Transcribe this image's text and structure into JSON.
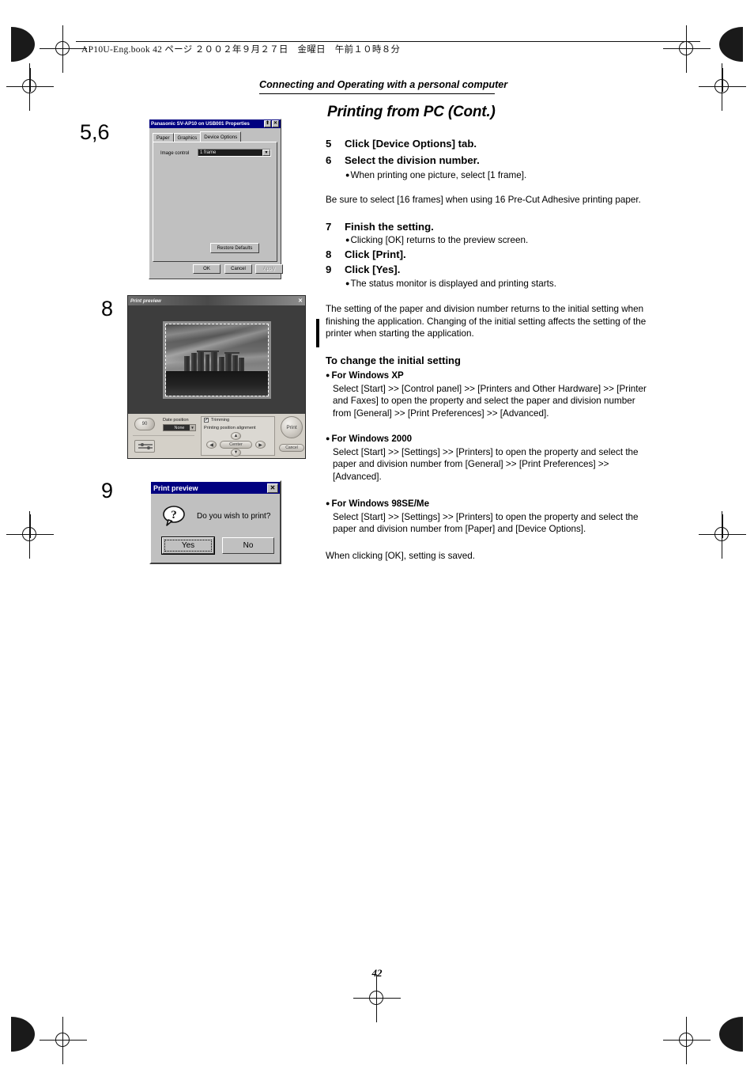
{
  "page": {
    "book_header": "AP10U-Eng.book  42 ページ  ２００２年９月２７日　金曜日　午前１０時８分",
    "section_label": "Connecting and Operating with a personal computer",
    "title": "Printing from PC (Cont.)",
    "folio": "42"
  },
  "gutter": {
    "step56": "5,6",
    "step8": "8",
    "step9": "9"
  },
  "steps": [
    {
      "num": "5",
      "text": "Click [Device Options] tab."
    },
    {
      "num": "6",
      "text": "Select the division number."
    },
    {
      "num": "7",
      "text": "Finish the setting."
    },
    {
      "num": "8",
      "text": "Click [Print]."
    },
    {
      "num": "9",
      "text": "Click [Yes]."
    }
  ],
  "bullets": {
    "one_picture": "When printing one picture, select [1 frame].",
    "clicking_ok": "Clicking [OK] returns to the preview screen.",
    "status_monitor": "The status monitor is displayed and printing starts.",
    "dot": "●"
  },
  "paragraphs": {
    "precut": "Be sure to select [16 frames] when using 16 Pre-Cut Adhesive printing paper.",
    "initial_setting": "The setting of the paper and division number returns to the initial setting when finishing the application. Changing of the initial setting affects the setting of the printer when starting the application.",
    "when_clicking_ok": "When clicking [OK], setting is saved."
  },
  "sub_head": "To change the initial setting",
  "os_sections": [
    {
      "head": "For Windows XP",
      "body": "Select [Start] >> [Control panel] >> [Printers and Other Hardware] >> [Printer and Faxes] to open the property and select the paper and division number from [General] >> [Print Preferences] >> [Advanced]."
    },
    {
      "head": "For Windows 2000",
      "body": "Select [Start] >> [Settings] >> [Printers] to open the property and select the paper and division number from [General] >> [Print Preferences] >> [Advanced]."
    },
    {
      "head": "For Windows 98SE/Me",
      "body": "Select [Start] >> [Settings] >> [Printers] to open the property and select the paper and division number from [Paper] and [Device Options]."
    }
  ],
  "properties_dialog": {
    "title": "Panasonic SV-AP10 on USB001 Properties",
    "minimize_glyph": "⬆",
    "close_glyph": "✕",
    "tabs": [
      {
        "label": "Paper",
        "active": false
      },
      {
        "label": "Graphics",
        "active": false
      },
      {
        "label": "Device Options",
        "active": true
      }
    ],
    "field_label": "Image control",
    "field_value": "1 frame",
    "dropdown_glyph": "▼",
    "restore_defaults": "Restore Defaults",
    "ok": "OK",
    "cancel": "Cancel",
    "apply": "Apply"
  },
  "print_preview_window": {
    "title": "Print preview",
    "close_glyph": "✕",
    "rotate_label": "90",
    "date_position_label": "Date position",
    "date_position_value": "None",
    "trimming_label": "Trimming",
    "trimming_checked": "✔",
    "alignment_label": "Printing position alignment",
    "center_label": "Center",
    "arrow_up": "▲",
    "arrow_down": "▼",
    "arrow_left": "◀",
    "arrow_right": "▶",
    "print_button": "Print",
    "cancel_button": "Cancel"
  },
  "confirm_dialog": {
    "title": "Print preview",
    "close_glyph": "✕",
    "icon": "question-mark-icon",
    "message": "Do you wish to print?",
    "yes": "Yes",
    "yes_mnemonic": "Y",
    "no": "No",
    "no_mnemonic": "N"
  }
}
